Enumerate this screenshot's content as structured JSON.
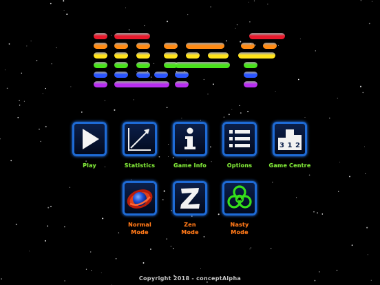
{
  "title": "iDEF",
  "logo_colors": [
    "#e8192c",
    "#ff8a12",
    "#ffe21a",
    "#48e21a",
    "#2a55ff",
    "#b82ef0"
  ],
  "menu_main": [
    {
      "label": "Play",
      "icon": "play-icon"
    },
    {
      "label": "Statistics",
      "icon": "statistics-icon"
    },
    {
      "label": "Game Info",
      "icon": "info-icon"
    },
    {
      "label": "Options",
      "icon": "options-list-icon"
    },
    {
      "label": "Game Centre",
      "icon": "podium-icon",
      "podium_numbers": [
        "3",
        "1",
        "2"
      ]
    }
  ],
  "menu_modes": [
    {
      "label": "Normal\nMode",
      "icon": "planet-icon"
    },
    {
      "label": "Zen\nMode",
      "icon": "zen-z-icon"
    },
    {
      "label": "Nasty\nMode",
      "icon": "biohazard-icon"
    }
  ],
  "label_color_main": "#7fe23a",
  "label_color_modes": "#ff7a1a",
  "accent_border": "#1e6bd6",
  "copyright": "Copyright 2018 - conceptAlpha"
}
